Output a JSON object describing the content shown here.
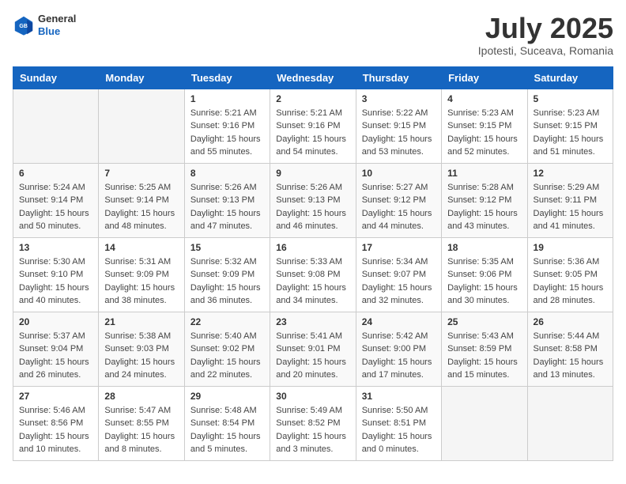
{
  "header": {
    "logo": {
      "general": "General",
      "blue": "Blue"
    },
    "title": "July 2025",
    "location": "Ipotesti, Suceava, Romania"
  },
  "weekdays": [
    "Sunday",
    "Monday",
    "Tuesday",
    "Wednesday",
    "Thursday",
    "Friday",
    "Saturday"
  ],
  "weeks": [
    [
      {
        "day": null
      },
      {
        "day": null
      },
      {
        "day": 1,
        "sunrise": "Sunrise: 5:21 AM",
        "sunset": "Sunset: 9:16 PM",
        "daylight": "Daylight: 15 hours and 55 minutes."
      },
      {
        "day": 2,
        "sunrise": "Sunrise: 5:21 AM",
        "sunset": "Sunset: 9:16 PM",
        "daylight": "Daylight: 15 hours and 54 minutes."
      },
      {
        "day": 3,
        "sunrise": "Sunrise: 5:22 AM",
        "sunset": "Sunset: 9:15 PM",
        "daylight": "Daylight: 15 hours and 53 minutes."
      },
      {
        "day": 4,
        "sunrise": "Sunrise: 5:23 AM",
        "sunset": "Sunset: 9:15 PM",
        "daylight": "Daylight: 15 hours and 52 minutes."
      },
      {
        "day": 5,
        "sunrise": "Sunrise: 5:23 AM",
        "sunset": "Sunset: 9:15 PM",
        "daylight": "Daylight: 15 hours and 51 minutes."
      }
    ],
    [
      {
        "day": 6,
        "sunrise": "Sunrise: 5:24 AM",
        "sunset": "Sunset: 9:14 PM",
        "daylight": "Daylight: 15 hours and 50 minutes."
      },
      {
        "day": 7,
        "sunrise": "Sunrise: 5:25 AM",
        "sunset": "Sunset: 9:14 PM",
        "daylight": "Daylight: 15 hours and 48 minutes."
      },
      {
        "day": 8,
        "sunrise": "Sunrise: 5:26 AM",
        "sunset": "Sunset: 9:13 PM",
        "daylight": "Daylight: 15 hours and 47 minutes."
      },
      {
        "day": 9,
        "sunrise": "Sunrise: 5:26 AM",
        "sunset": "Sunset: 9:13 PM",
        "daylight": "Daylight: 15 hours and 46 minutes."
      },
      {
        "day": 10,
        "sunrise": "Sunrise: 5:27 AM",
        "sunset": "Sunset: 9:12 PM",
        "daylight": "Daylight: 15 hours and 44 minutes."
      },
      {
        "day": 11,
        "sunrise": "Sunrise: 5:28 AM",
        "sunset": "Sunset: 9:12 PM",
        "daylight": "Daylight: 15 hours and 43 minutes."
      },
      {
        "day": 12,
        "sunrise": "Sunrise: 5:29 AM",
        "sunset": "Sunset: 9:11 PM",
        "daylight": "Daylight: 15 hours and 41 minutes."
      }
    ],
    [
      {
        "day": 13,
        "sunrise": "Sunrise: 5:30 AM",
        "sunset": "Sunset: 9:10 PM",
        "daylight": "Daylight: 15 hours and 40 minutes."
      },
      {
        "day": 14,
        "sunrise": "Sunrise: 5:31 AM",
        "sunset": "Sunset: 9:09 PM",
        "daylight": "Daylight: 15 hours and 38 minutes."
      },
      {
        "day": 15,
        "sunrise": "Sunrise: 5:32 AM",
        "sunset": "Sunset: 9:09 PM",
        "daylight": "Daylight: 15 hours and 36 minutes."
      },
      {
        "day": 16,
        "sunrise": "Sunrise: 5:33 AM",
        "sunset": "Sunset: 9:08 PM",
        "daylight": "Daylight: 15 hours and 34 minutes."
      },
      {
        "day": 17,
        "sunrise": "Sunrise: 5:34 AM",
        "sunset": "Sunset: 9:07 PM",
        "daylight": "Daylight: 15 hours and 32 minutes."
      },
      {
        "day": 18,
        "sunrise": "Sunrise: 5:35 AM",
        "sunset": "Sunset: 9:06 PM",
        "daylight": "Daylight: 15 hours and 30 minutes."
      },
      {
        "day": 19,
        "sunrise": "Sunrise: 5:36 AM",
        "sunset": "Sunset: 9:05 PM",
        "daylight": "Daylight: 15 hours and 28 minutes."
      }
    ],
    [
      {
        "day": 20,
        "sunrise": "Sunrise: 5:37 AM",
        "sunset": "Sunset: 9:04 PM",
        "daylight": "Daylight: 15 hours and 26 minutes."
      },
      {
        "day": 21,
        "sunrise": "Sunrise: 5:38 AM",
        "sunset": "Sunset: 9:03 PM",
        "daylight": "Daylight: 15 hours and 24 minutes."
      },
      {
        "day": 22,
        "sunrise": "Sunrise: 5:40 AM",
        "sunset": "Sunset: 9:02 PM",
        "daylight": "Daylight: 15 hours and 22 minutes."
      },
      {
        "day": 23,
        "sunrise": "Sunrise: 5:41 AM",
        "sunset": "Sunset: 9:01 PM",
        "daylight": "Daylight: 15 hours and 20 minutes."
      },
      {
        "day": 24,
        "sunrise": "Sunrise: 5:42 AM",
        "sunset": "Sunset: 9:00 PM",
        "daylight": "Daylight: 15 hours and 17 minutes."
      },
      {
        "day": 25,
        "sunrise": "Sunrise: 5:43 AM",
        "sunset": "Sunset: 8:59 PM",
        "daylight": "Daylight: 15 hours and 15 minutes."
      },
      {
        "day": 26,
        "sunrise": "Sunrise: 5:44 AM",
        "sunset": "Sunset: 8:58 PM",
        "daylight": "Daylight: 15 hours and 13 minutes."
      }
    ],
    [
      {
        "day": 27,
        "sunrise": "Sunrise: 5:46 AM",
        "sunset": "Sunset: 8:56 PM",
        "daylight": "Daylight: 15 hours and 10 minutes."
      },
      {
        "day": 28,
        "sunrise": "Sunrise: 5:47 AM",
        "sunset": "Sunset: 8:55 PM",
        "daylight": "Daylight: 15 hours and 8 minutes."
      },
      {
        "day": 29,
        "sunrise": "Sunrise: 5:48 AM",
        "sunset": "Sunset: 8:54 PM",
        "daylight": "Daylight: 15 hours and 5 minutes."
      },
      {
        "day": 30,
        "sunrise": "Sunrise: 5:49 AM",
        "sunset": "Sunset: 8:52 PM",
        "daylight": "Daylight: 15 hours and 3 minutes."
      },
      {
        "day": 31,
        "sunrise": "Sunrise: 5:50 AM",
        "sunset": "Sunset: 8:51 PM",
        "daylight": "Daylight: 15 hours and 0 minutes."
      },
      {
        "day": null
      },
      {
        "day": null
      }
    ]
  ]
}
